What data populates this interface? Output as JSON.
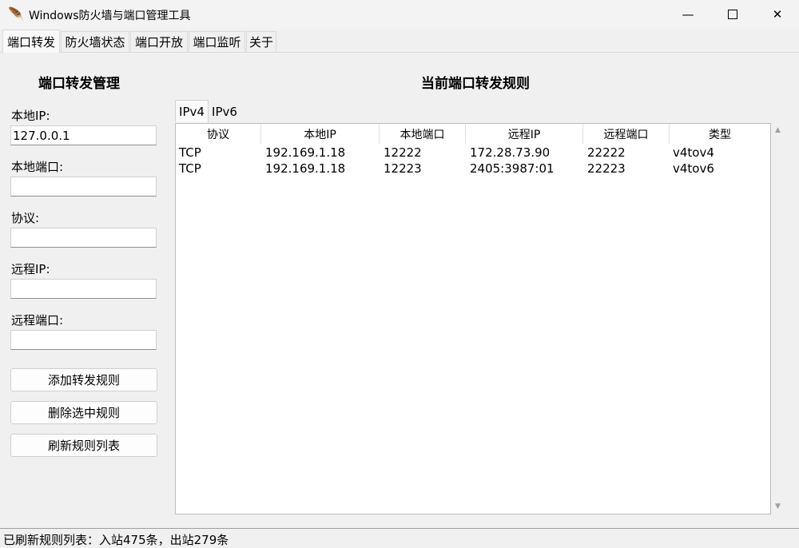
{
  "window": {
    "title": "Windows防火墙与端口管理工具",
    "minimize_glyph": "—",
    "close_glyph": "✕"
  },
  "main_tabs": [
    "端口转发",
    "防火墙状态",
    "端口开放",
    "端口监听",
    "关于"
  ],
  "left_panel": {
    "heading": "端口转发管理",
    "fields": [
      {
        "label": "本地IP:",
        "value": "127.0.0.1"
      },
      {
        "label": "本地端口:",
        "value": ""
      },
      {
        "label": "协议:",
        "value": ""
      },
      {
        "label": "远程IP:",
        "value": ""
      },
      {
        "label": "远程端口:",
        "value": ""
      }
    ],
    "buttons": [
      "添加转发规则",
      "删除选中规则",
      "刷新规则列表"
    ]
  },
  "right_panel": {
    "heading": "当前端口转发规则",
    "subtabs": [
      "IPv4",
      "IPv6"
    ],
    "columns": [
      "协议",
      "本地IP",
      "本地端口",
      "远程IP",
      "远程端口",
      "类型"
    ],
    "rows": [
      [
        "TCP",
        "192.169.1.18",
        "12222",
        "172.28.73.90",
        "22222",
        "v4tov4"
      ],
      [
        "TCP",
        "192.169.1.18",
        "12223",
        "2405:3987:01",
        "22223",
        "v4tov6"
      ]
    ]
  },
  "status": "已刷新规则列表：入站475条，出站279条"
}
